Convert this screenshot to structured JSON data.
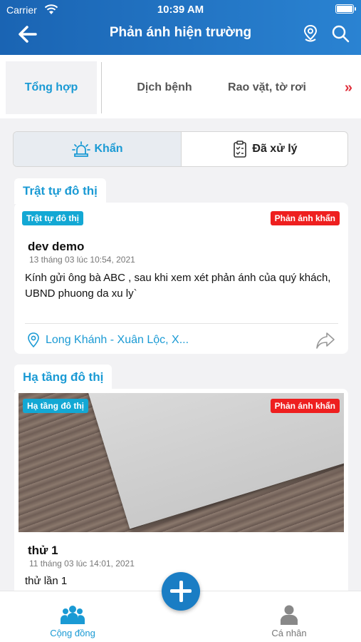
{
  "status_bar": {
    "carrier": "Carrier",
    "time": "10:39 AM"
  },
  "header": {
    "title": "Phản ánh hiện trường"
  },
  "category_tabs": [
    {
      "label": "Tổng hợp",
      "active": true
    },
    {
      "label": "Dịch bệnh",
      "active": false
    },
    {
      "label": "Rao vặt, tờ rơi",
      "active": false
    }
  ],
  "category_more": "»",
  "segment": [
    {
      "label": "Khẩn",
      "icon": "alarm-icon",
      "active": true
    },
    {
      "label": "Đã xử lý",
      "icon": "checklist-icon",
      "active": false
    }
  ],
  "posts": [
    {
      "section": "Trật tự đô thị",
      "category_chip": "Trật tự đô thị",
      "urgent_chip": "Phản ánh khẩn",
      "title": "dev demo",
      "date": "13 tháng 03 lúc 10:54, 2021",
      "body": "Kính gửi ông bà ABC , sau khi xem xét phản ánh của quý khách, UBND phuong da xu ly`",
      "location": "Long Khánh - Xuân Lộc, X..."
    },
    {
      "section": "Hạ tầng đô thị",
      "category_chip": "Hạ tầng đô thị",
      "urgent_chip": "Phản ánh khẩn",
      "title": "thử 1",
      "date": "11 tháng 03 lúc 14:01, 2021",
      "body": "thử lần 1"
    }
  ],
  "bottom_nav": {
    "left": {
      "label": "Cộng đồng",
      "icon": "community-icon",
      "active": true
    },
    "right": {
      "label": "Cá nhân",
      "icon": "person-icon",
      "active": false
    }
  },
  "colors": {
    "primary": "#1a9ad4",
    "header": "#1a64b3",
    "urgent": "#ee1f1f",
    "fab": "#1a7dc4"
  }
}
